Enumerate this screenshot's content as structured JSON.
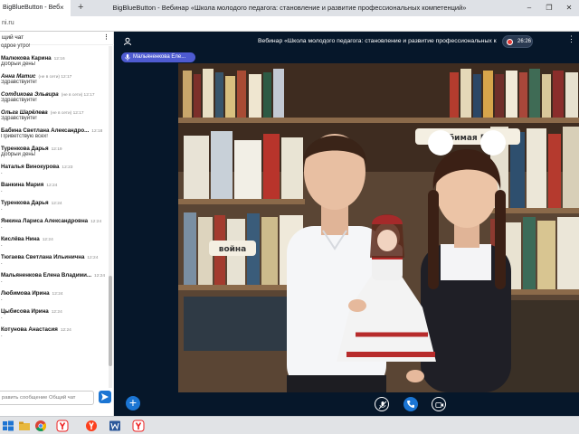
{
  "browser": {
    "tab_title": "BigBlueButton - Веб",
    "tab_close": "×",
    "new_tab": "+",
    "window_title": "BigBlueButton - Вебинар «Школа молодого педагога: становление и развитие профессиональных компетенций»",
    "address": "ni.ru",
    "controls": [
      "–",
      "❐",
      "✕"
    ]
  },
  "chat": {
    "title": "щий чат",
    "menu": "⋮",
    "messages": [
      {
        "name": "",
        "meta": "",
        "text": "одрое утро!"
      },
      {
        "name": "Малюкова Карина",
        "meta": "12:16",
        "text": "Добрый день!"
      },
      {
        "name": "Анна Матис",
        "meta": "(не в сети)  12:17",
        "text": "Здравствуйте!",
        "italic": true
      },
      {
        "name": "Сотдикова Эльвира",
        "meta": "(не в сети)  12:17",
        "text": "Здравствуйте!",
        "italic": true
      },
      {
        "name": "Ольга Шарёлева",
        "meta": "(не в сети)  12:17",
        "text": "Здравствуйте!",
        "italic": true
      },
      {
        "name": "Бабина Светлана Александро...",
        "meta": "12:18",
        "text": "Приветствую всех!"
      },
      {
        "name": "Туренкова Дарья",
        "meta": "12:19",
        "text": "Добрый день!"
      },
      {
        "name": "Наталья Винокурова",
        "meta": "12:23",
        "text": "."
      },
      {
        "name": "Ванкина Мария",
        "meta": "12:24",
        "text": "."
      },
      {
        "name": "Туренкова Дарья",
        "meta": "12:24",
        "text": "."
      },
      {
        "name": "Янкина Лариса Александровна",
        "meta": "12:24",
        "text": "."
      },
      {
        "name": "Кислёва Нина",
        "meta": "12:24",
        "text": "."
      },
      {
        "name": "Тюгаева Светлана Ильинична",
        "meta": "12:24",
        "text": "."
      },
      {
        "name": "Мальяненкова Елена Владими...",
        "meta": "12:24",
        "text": "."
      },
      {
        "name": "Любимова Ирина",
        "meta": "12:24",
        "text": "."
      },
      {
        "name": "Цыбисова Ирина",
        "meta": "12:24",
        "text": "."
      },
      {
        "name": "Котунова Анастасия",
        "meta": "12:24",
        "text": "."
      }
    ],
    "input_placeholder": "равить сообщение Общий чат"
  },
  "session": {
    "title": "Вебинар «Школа молодого педагога: становление и развитие профессиональных компетенций»",
    "rec_time": "26:26",
    "menu": "⋮",
    "presenter": "Мальяненкова Еле..."
  },
  "video": {
    "sign_left": "война",
    "sign_right": "Любимая Русь"
  },
  "controls": {
    "plus": "+"
  },
  "colors": {
    "bg": "#06172a",
    "accent": "#1b75d3",
    "presenter": "#4e5bd1",
    "rec": "#e53935"
  }
}
